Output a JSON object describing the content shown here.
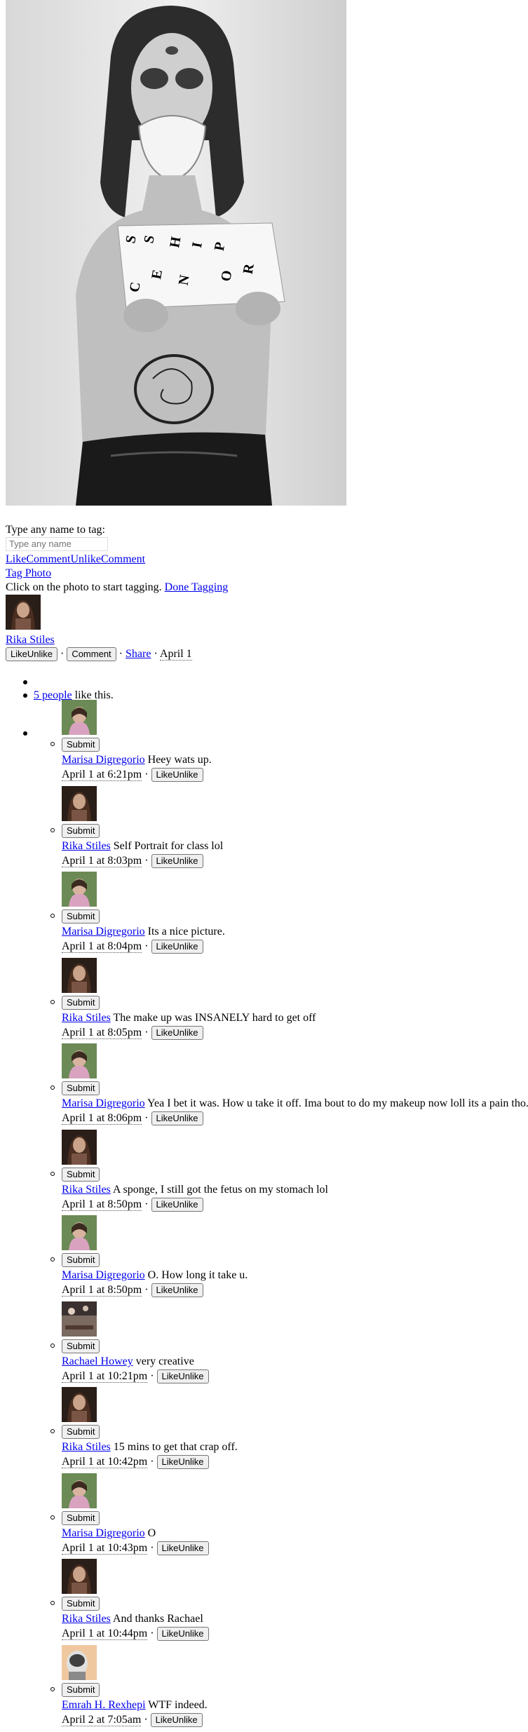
{
  "photo": {
    "sign_letters": [
      "C",
      "E",
      "N",
      "S",
      "O",
      "R",
      "S",
      "H",
      "I",
      "P"
    ]
  },
  "tagging": {
    "label": "Type any name to tag:",
    "input_placeholder": "Type any name",
    "like_links": [
      "Like",
      "Comment",
      "Unlike",
      "Comment"
    ],
    "tag_photo": "Tag Photo",
    "instruction": "Click on the photo to start tagging.",
    "done_tagging": "Done Tagging"
  },
  "owner": {
    "name": "Rika Stiles"
  },
  "actions": {
    "like_button": "LikeUnlike",
    "comment_button": "Comment",
    "share": "Share",
    "date": "April 1",
    "separator": "·"
  },
  "likes": {
    "count_link": "5 people",
    "suffix": "like this."
  },
  "comments": [
    {
      "author": "Marisa Digregorio",
      "avatar": "marisa",
      "text": "Heey wats up.",
      "time": "April 1 at 6:21pm",
      "like": "LikeUnlike",
      "submit": "Submit"
    },
    {
      "author": "Rika Stiles",
      "avatar": "rika",
      "text": "Self Portrait for class lol",
      "time": "April 1 at 8:03pm",
      "like": "LikeUnlike",
      "submit": "Submit"
    },
    {
      "author": "Marisa Digregorio",
      "avatar": "marisa",
      "text": "Its a nice picture.",
      "time": "April 1 at 8:04pm",
      "like": "LikeUnlike",
      "submit": "Submit"
    },
    {
      "author": "Rika Stiles",
      "avatar": "rika",
      "text": "The make up was INSANELY hard to get off",
      "time": "April 1 at 8:05pm",
      "like": "LikeUnlike",
      "submit": "Submit"
    },
    {
      "author": "Marisa Digregorio",
      "avatar": "marisa",
      "text": "Yea I bet it was. How u take it off. Ima bout to do my makeup now loll its a pain tho.",
      "time": "April 1 at 8:06pm",
      "like": "LikeUnlike",
      "submit": "Submit"
    },
    {
      "author": "Rika Stiles",
      "avatar": "rika",
      "text": "A sponge, I still got the fetus on my stomach lol",
      "time": "April 1 at 8:50pm",
      "like": "LikeUnlike",
      "submit": "Submit"
    },
    {
      "author": "Marisa Digregorio",
      "avatar": "marisa",
      "text": "O. How long it take u.",
      "time": "April 1 at 8:50pm",
      "like": "LikeUnlike",
      "submit": "Submit"
    },
    {
      "author": "Rachael Howey",
      "avatar": "rachael",
      "text": "very creative",
      "time": "April 1 at 10:21pm",
      "like": "LikeUnlike",
      "submit": "Submit"
    },
    {
      "author": "Rika Stiles",
      "avatar": "rika",
      "text": "15 mins to get that crap off.",
      "time": "April 1 at 10:42pm",
      "like": "LikeUnlike",
      "submit": "Submit"
    },
    {
      "author": "Marisa Digregorio",
      "avatar": "marisa",
      "text": "O",
      "time": "April 1 at 10:43pm",
      "like": "LikeUnlike",
      "submit": "Submit"
    },
    {
      "author": "Rika Stiles",
      "avatar": "rika",
      "text": "And thanks Rachael",
      "time": "April 1 at 10:44pm",
      "like": "LikeUnlike",
      "submit": "Submit"
    },
    {
      "author": "Emrah H. Rexhepi",
      "avatar": "emrah",
      "text": "WTF indeed.",
      "time": "April 2 at 7:05am",
      "like": "LikeUnlike",
      "submit": "Submit"
    }
  ]
}
